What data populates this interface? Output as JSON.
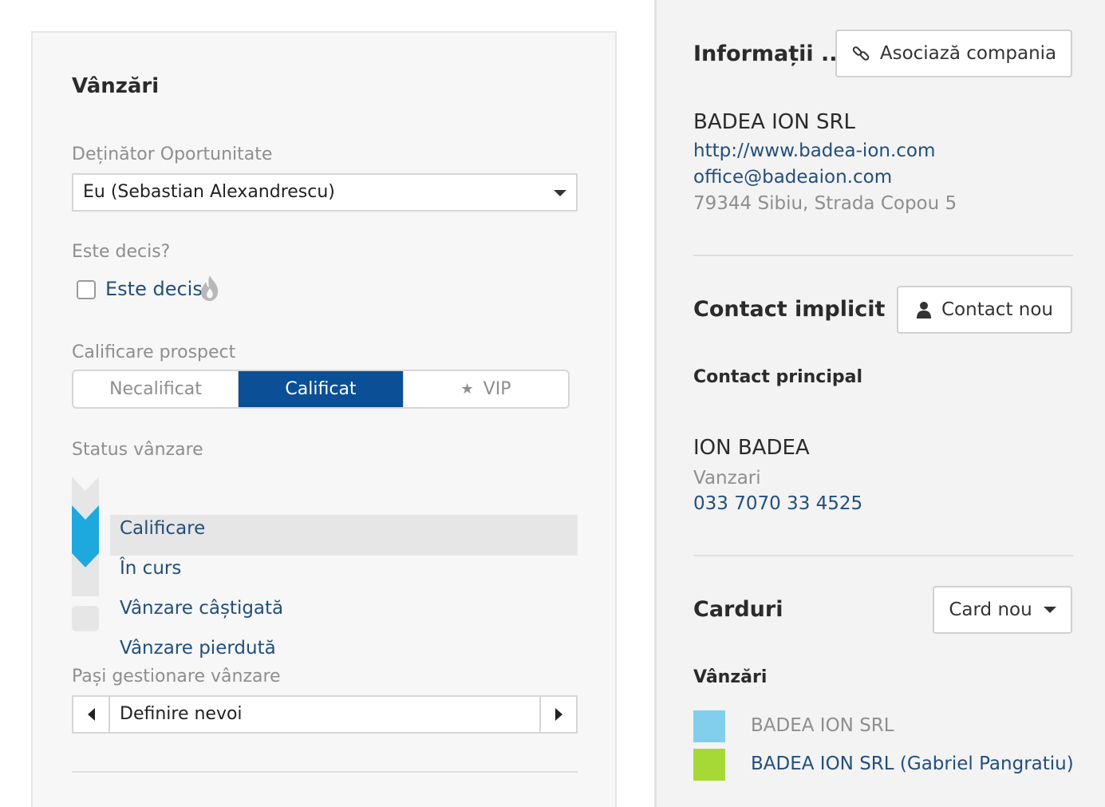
{
  "sales": {
    "title": "Vânzări",
    "owner_label": "Deținător Oportunitate",
    "owner_value": "Eu (Sebastian Alexandrescu)",
    "decided_label": "Este decis?",
    "decided_checkbox_label": "Este decis",
    "decided_checked": false,
    "qualification_label": "Calificare prospect",
    "qualification_options": [
      "Necalificat",
      "Calificat",
      "VIP"
    ],
    "qualification_selected": "Calificat",
    "status_label": "Status vânzare",
    "status_items": [
      "Calificare",
      "În curs",
      "Vânzare câștigată",
      "Vânzare pierdută"
    ],
    "status_active": "În curs",
    "steps_label": "Pași gestionare vânzare",
    "steps_value": "Definire nevoi"
  },
  "company": {
    "title": "Informații ...",
    "associate_button": "Asociază compania",
    "name": "BADEA ION SRL",
    "website": "http://www.badea-ion.com",
    "email": "office@badeaion.com",
    "address": "79344 Sibiu, Strada Copou 5"
  },
  "contact": {
    "title": "Contact implicit",
    "new_button": "Contact nou",
    "subtitle": "Contact principal",
    "name": "ION BADEA",
    "department": "Vanzari",
    "phone": "033 7070 33 4525"
  },
  "cards": {
    "title": "Carduri",
    "new_button": "Card nou",
    "section": "Vânzări",
    "items": [
      {
        "label": "BADEA ION SRL",
        "color": "#82cfed"
      },
      {
        "label": "BADEA ION SRL (Gabriel Pangratiu)",
        "color": "#a6d935"
      }
    ]
  },
  "colors": {
    "accent": "#0b4f96",
    "pipeline_active": "#1ea9de",
    "link": "#234f7a"
  }
}
